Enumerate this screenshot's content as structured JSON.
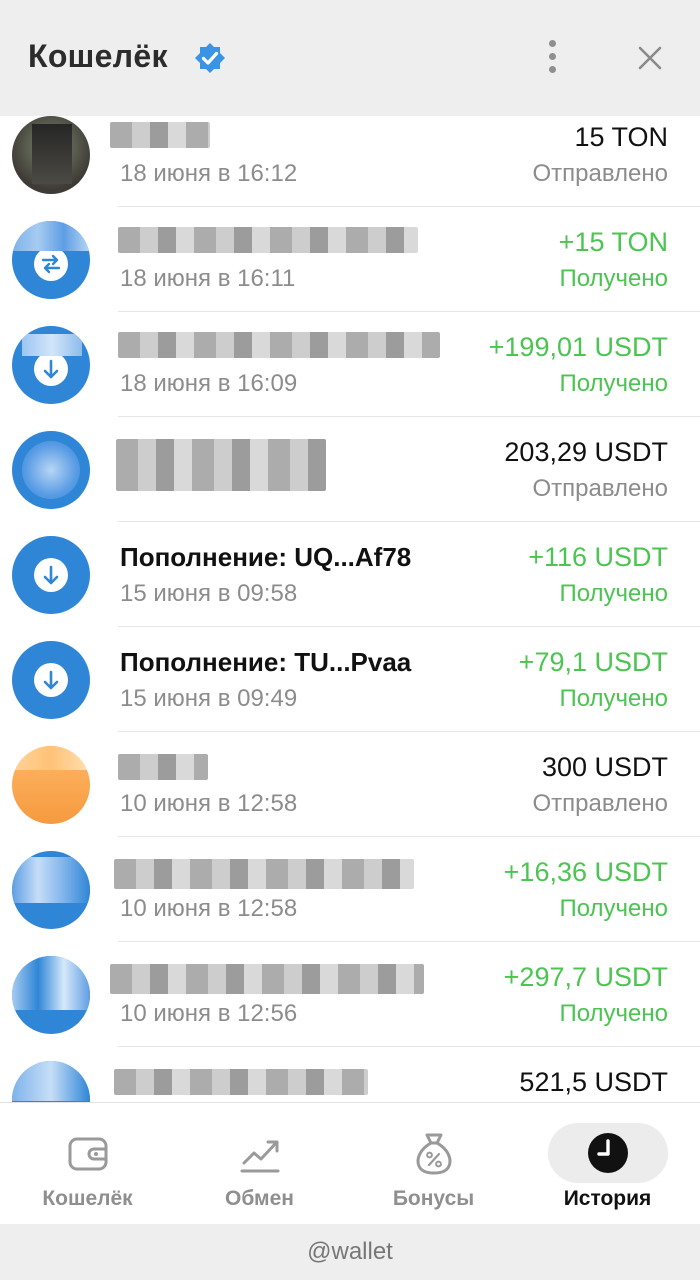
{
  "header": {
    "title": "Кошелёк"
  },
  "transactions": [
    {
      "name": "",
      "date": "18 июня в 16:12",
      "amount": "15 TON",
      "status": "Отправлено",
      "direction": "out"
    },
    {
      "name": "",
      "date": "18 июня в 16:11",
      "amount": "+15 TON",
      "status": "Получено",
      "direction": "in"
    },
    {
      "name": "",
      "date": "18 июня в 16:09",
      "amount": "+199,01 USDT",
      "status": "Получено",
      "direction": "in"
    },
    {
      "name": "",
      "date": "",
      "amount": "203,29 USDT",
      "status": "Отправлено",
      "direction": "out"
    },
    {
      "name": "Пополнение: UQ...Af78",
      "date": "15 июня в 09:58",
      "amount": "+116 USDT",
      "status": "Получено",
      "direction": "in"
    },
    {
      "name": "Пополнение: TU...Pvaa",
      "date": "15 июня в 09:49",
      "amount": "+79,1 USDT",
      "status": "Получено",
      "direction": "in"
    },
    {
      "name": "",
      "date": "10 июня в 12:58",
      "amount": "300 USDT",
      "status": "Отправлено",
      "direction": "out"
    },
    {
      "name": "",
      "date": "10 июня в 12:58",
      "amount": "+16,36 USDT",
      "status": "Получено",
      "direction": "in"
    },
    {
      "name": "",
      "date": "10 июня в 12:56",
      "amount": "+297,7 USDT",
      "status": "Получено",
      "direction": "in"
    },
    {
      "name": "",
      "date": "",
      "amount": "521,5 USDT",
      "status": "",
      "direction": "out"
    }
  ],
  "tabs": [
    {
      "label": "Кошелёк",
      "icon": "wallet-icon"
    },
    {
      "label": "Обмен",
      "icon": "chart-trend-icon"
    },
    {
      "label": "Бонусы",
      "icon": "money-bag-percent-icon"
    },
    {
      "label": "История",
      "icon": "clock-icon",
      "active": true
    }
  ],
  "footer": {
    "handle": "@wallet"
  },
  "colors": {
    "accent_blue": "#2f86d6",
    "income_green": "#4cc452",
    "muted_gray": "#8c8c8c"
  }
}
